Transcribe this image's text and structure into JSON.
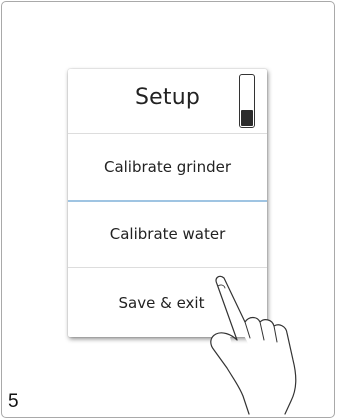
{
  "menu": {
    "title": "Setup",
    "scroll_position_fraction": 0.33,
    "items": [
      {
        "label": "Calibrate grinder"
      },
      {
        "label": "Calibrate water"
      },
      {
        "label": "Save & exit",
        "touched": true
      }
    ]
  },
  "page_number": "5",
  "icons": {
    "scroll_indicator": "scrollbar-indicator",
    "hand": "pointing-hand-icon"
  },
  "colors": {
    "active_divider": "#9fc4e2"
  }
}
